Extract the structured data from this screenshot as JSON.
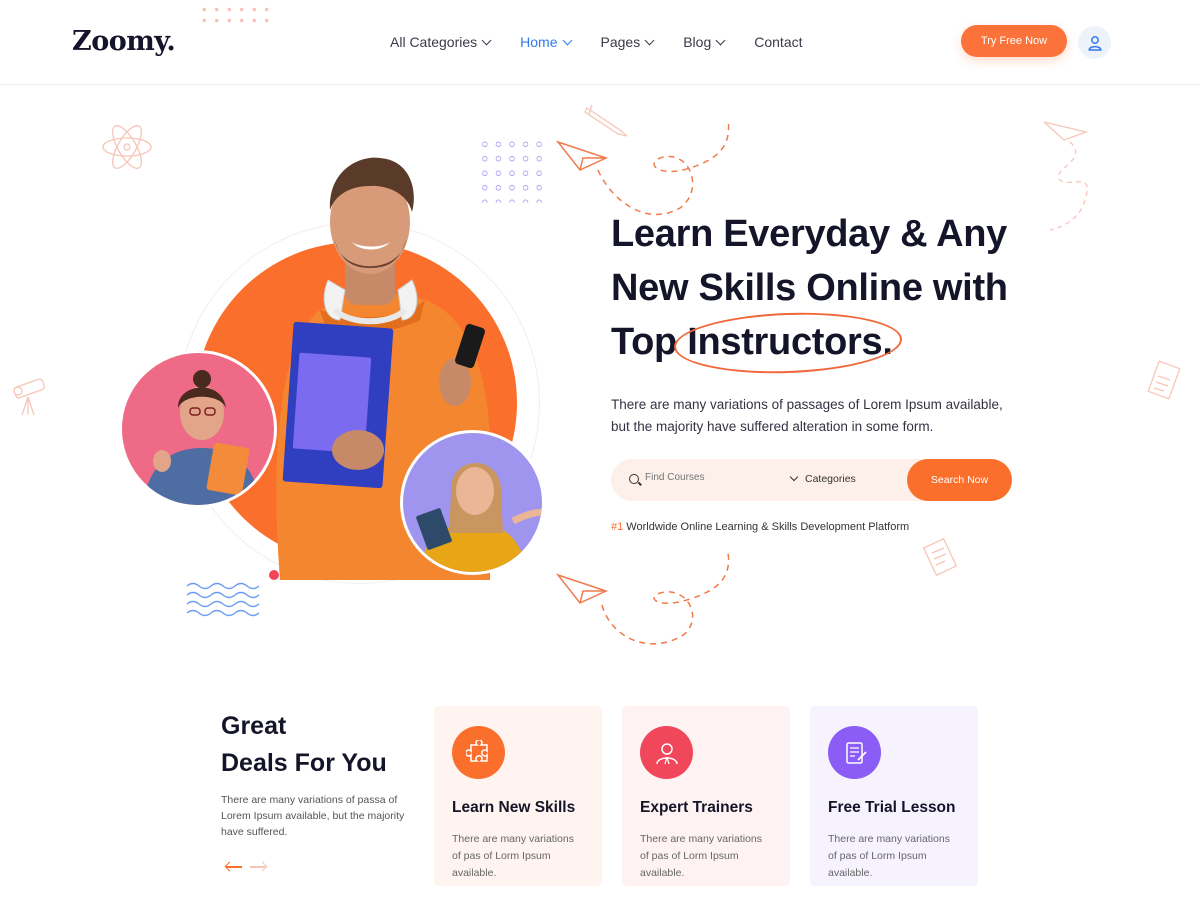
{
  "brand": {
    "logo": "Zoomy."
  },
  "nav": {
    "items": [
      {
        "label": "All Categories",
        "has_dropdown": true,
        "active": false
      },
      {
        "label": "Home",
        "has_dropdown": true,
        "active": true
      },
      {
        "label": "Pages",
        "has_dropdown": true,
        "active": false
      },
      {
        "label": "Blog",
        "has_dropdown": true,
        "active": false
      },
      {
        "label": "Contact",
        "has_dropdown": false,
        "active": false
      }
    ],
    "cta_label": "Try Free Now",
    "user_icon": "user-icon"
  },
  "hero": {
    "title_line1": "Learn Everyday & Any",
    "title_line2": "New Skills Online with",
    "title_line3_prefix": "Top ",
    "title_line3_highlight": "Instructors.",
    "description": "There are many variations of passages of Lorem Ipsum available, but the majority have suffered alteration in some form.",
    "search": {
      "placeholder": "Find Courses",
      "category_label": "Categories",
      "button_label": "Search Now"
    },
    "platform_hash": "#1",
    "platform_text": " Worldwide Online Learning & Skills Development Platform"
  },
  "deals": {
    "title_line1": "Great",
    "title_line2": "Deals For You",
    "description": "There are many variations of passa of Lorem Ipsum available, but the majority have suffered."
  },
  "cards": [
    {
      "title": "Learn New Skills",
      "desc": "There are many variations of pas of Lorm Ipsum available.",
      "icon": "puzzle-icon",
      "accent": "#fb6f2c",
      "bg": "#fff4ef"
    },
    {
      "title": "Expert Trainers",
      "desc": "There are many variations of pas of Lorm Ipsum available.",
      "icon": "trainer-icon",
      "accent": "#f0475a",
      "bg": "#fff2f3"
    },
    {
      "title": "Free Trial Lesson",
      "desc": "There are many variations of pas of Lorm Ipsum available.",
      "icon": "lesson-icon",
      "accent": "#8b5cf6",
      "bg": "#f6f3ff"
    }
  ],
  "colors": {
    "accent": "#fb6f2c",
    "nav_active": "#2f7bf0",
    "dark": "#15152a"
  }
}
